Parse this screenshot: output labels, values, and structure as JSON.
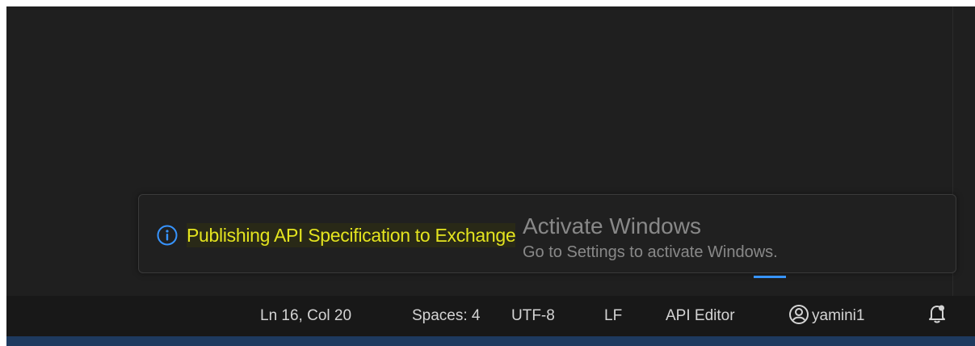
{
  "notification": {
    "icon": "info-icon",
    "message": "Publishing API Specification to Exchange"
  },
  "watermark": {
    "title": "Activate Windows",
    "subtitle": "Go to Settings to activate Windows."
  },
  "status_bar": {
    "position": "Ln 16, Col 20",
    "indentation": "Spaces: 4",
    "encoding": "UTF-8",
    "line_ending": "LF",
    "language_mode": "API Editor",
    "account_icon": "account-icon",
    "account_name": "yamini1",
    "notifications_icon": "bell-icon"
  },
  "colors": {
    "editor_background": "#1f1f1f",
    "status_bar_background": "#181818",
    "notification_text": "#e4e41f",
    "info_icon": "#3794ff",
    "status_text": "#d4d4d4"
  }
}
